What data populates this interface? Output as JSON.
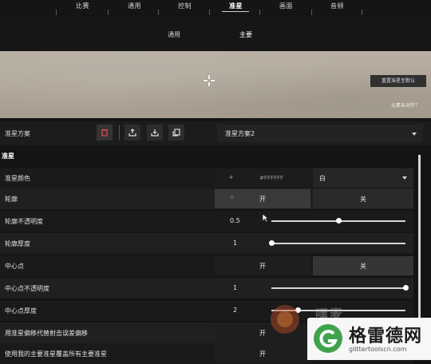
{
  "top_nav": {
    "tabs": [
      "比赛",
      "通用",
      "控制",
      "准星",
      "画面",
      "音频"
    ],
    "active": "准星"
  },
  "sub_nav": {
    "tabs": [
      "通用",
      "主要"
    ],
    "active": "主要"
  },
  "preview": {
    "reset_label": "重置准星至默认",
    "link_label": "元素未对齐？"
  },
  "profile": {
    "label": "准星方案",
    "selected": "准星方案2",
    "icons": [
      "delete-icon",
      "upload-icon",
      "download-icon",
      "copy-icon"
    ]
  },
  "section": {
    "title": "准星"
  },
  "rows": {
    "color": {
      "label": "准星颜色",
      "hex": "#FFFFFF",
      "hex_icon": "#",
      "value": "白"
    },
    "outline": {
      "label": "轮廓",
      "level": "8",
      "on": "开",
      "off": "关",
      "selected": "on"
    },
    "outline_opacity": {
      "label": "轮廓不透明度",
      "value": "0.5",
      "fraction": 0.5
    },
    "outline_thickness": {
      "label": "轮廓厚度",
      "value": "1",
      "fraction": 0.0
    },
    "center_dot": {
      "label": "中心点",
      "on": "开",
      "off": "关",
      "selected": "on"
    },
    "center_dot_opacity": {
      "label": "中心点不透明度",
      "value": "1",
      "fraction": 1.0
    },
    "center_dot_thickness": {
      "label": "中心点厚度",
      "value": "2",
      "fraction": 0.2
    },
    "firing_error_offset": {
      "label": "用准星偏移代替射击误差偏移",
      "on": "开"
    },
    "override_all": {
      "label": "使用我的主要准星覆盖所有主要准星",
      "on": "开"
    }
  },
  "watermarks": {
    "site_logo_text": "嘿麦",
    "brand_title": "格雷德网",
    "brand_url": "glittertoolscn.com"
  },
  "colors": {
    "background": "#141414",
    "row": "#1a1a1a",
    "row_alt": "#202020",
    "toggle_on": "#3a3a3a",
    "toggle_off": "#2a2a2a",
    "accent_white": "#ffffff",
    "brand_green": "#3fa34d"
  }
}
